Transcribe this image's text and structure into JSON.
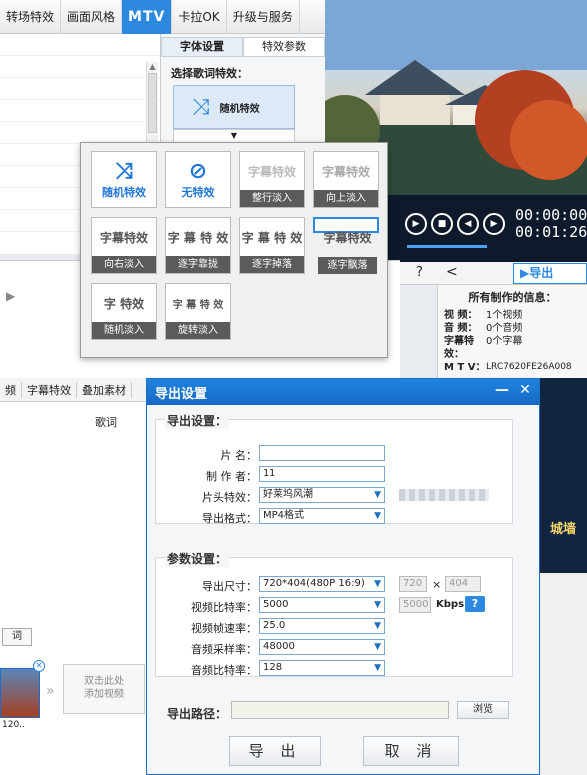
{
  "top_tabs": [
    "转场特效",
    "画面风格",
    "MTV",
    "卡拉OK",
    "升级与服务"
  ],
  "fx_subtabs": [
    "字体设置",
    "特效参数"
  ],
  "fx_label": "选择歌词特效：",
  "fx_selected": "随机特效",
  "timecodes": [
    "00:00:00",
    "00:01:26"
  ],
  "export_btn": "导出",
  "popup_tiles": [
    {
      "art": "",
      "cap": "随机特效"
    },
    {
      "art": "",
      "cap": "无特效"
    },
    {
      "art": "字幕特效",
      "cap": "整行淡入"
    },
    {
      "art": "字幕特效",
      "cap": "向上淡入"
    },
    {
      "art": "字幕特效",
      "cap": "向右淡入"
    },
    {
      "art": "字 幕 特 效",
      "cap": "逐字靠拢"
    },
    {
      "art": "字 幕 特 效",
      "cap": "逐字掉落"
    },
    {
      "art": "字幕特效",
      "cap": "逐字飘落"
    },
    {
      "art": "字  特效",
      "cap": "随机淡入"
    },
    {
      "art": "字 幕 特 效",
      "cap": "旋转淡入"
    }
  ],
  "info": {
    "title": "所有制作的信息：",
    "rows": [
      {
        "k": "视  频：",
        "v": "1个视频"
      },
      {
        "k": "音  频：",
        "v": "0个音频"
      },
      {
        "k": "字幕特效：",
        "v": "0个字幕"
      },
      {
        "k": "M  T  V：",
        "v": "LRC7620FE26A008"
      }
    ]
  },
  "bottom_tabs": [
    "频",
    "字幕特效",
    "叠加素材"
  ],
  "lyric_header": "歌词",
  "add_video": "双击此处\n添加视频",
  "thumb_label": "120..",
  "dialog": {
    "title": "导出设置",
    "sec1": "导出设置：",
    "name_label": "片    名：",
    "name_value": "",
    "author_label": "制 作 者：",
    "author_value": "11",
    "head_label": "片头特效：",
    "head_value": "好莱坞风潮",
    "format_label": "导出格式：",
    "format_value": "MP4格式",
    "sec2": "参数设置：",
    "size_label": "导出尺寸：",
    "size_value": "720*404(480P 16:9)",
    "w": "720",
    "h": "404",
    "x": "×",
    "vbr_label": "视频比特率：",
    "vbr_value": "5000",
    "vbr_custom": "5000",
    "kbps": "Kbps",
    "fps_label": "视频帧速率：",
    "fps_value": "25.0",
    "asr_label": "音频采样率：",
    "asr_value": "48000",
    "abr_label": "音频比特率：",
    "abr_value": "128",
    "path_label": "导出路径：",
    "browse": "浏览",
    "ok": "导 出",
    "cancel": "取 消"
  },
  "caption": "城墙",
  "left_btn": "词"
}
